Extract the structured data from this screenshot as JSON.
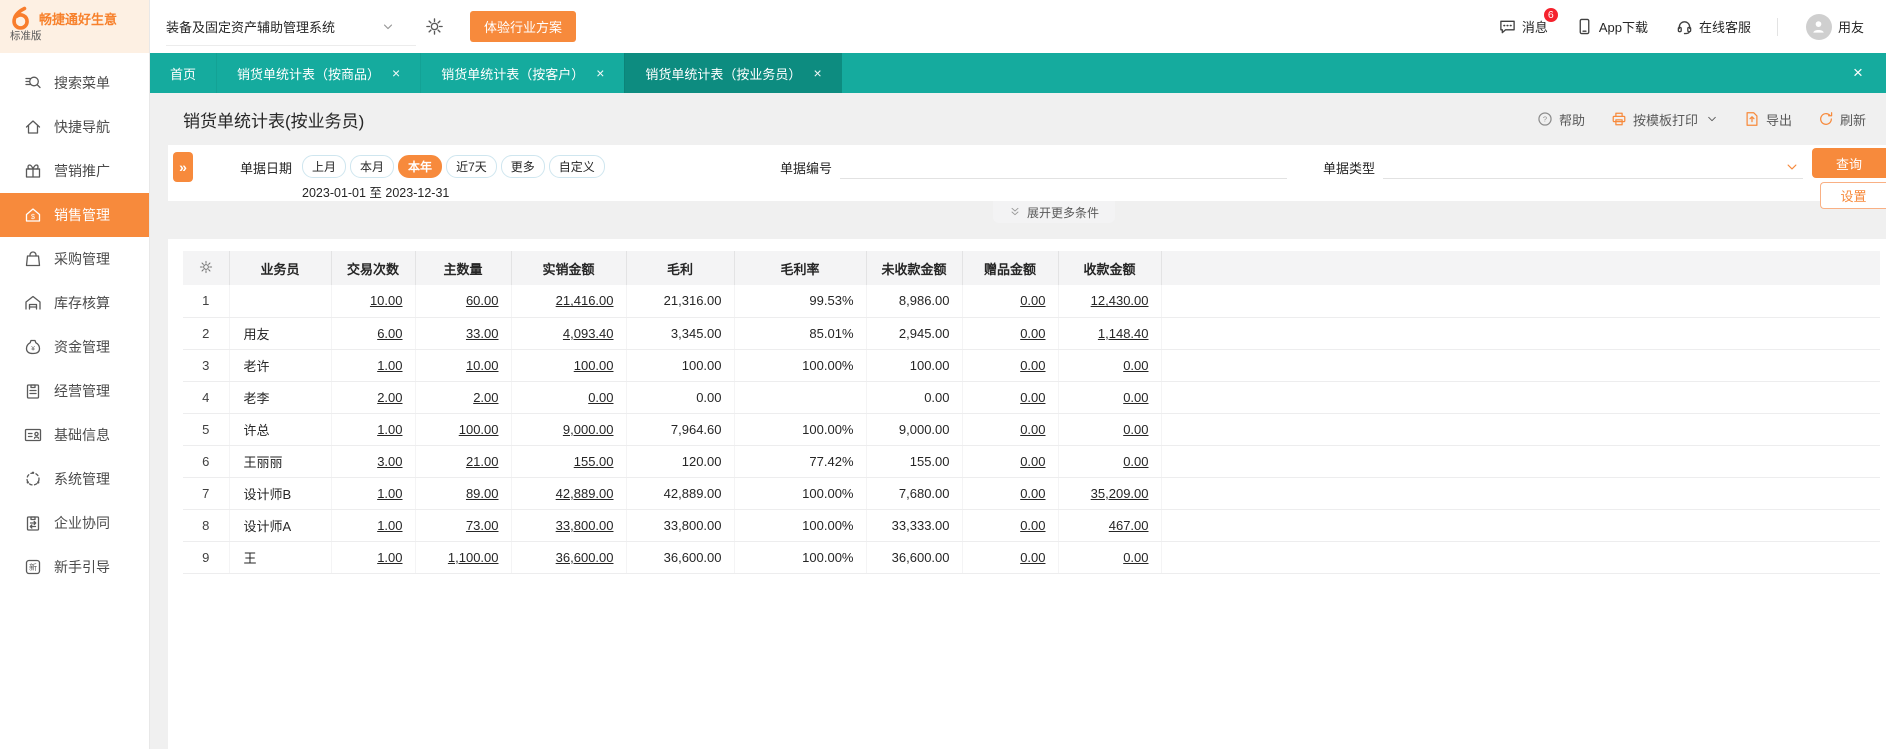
{
  "colors": {
    "accent": "#f78a3c",
    "teal": "#15ab9e",
    "teal_active": "#0d8c80",
    "badge_red": "#f5222d",
    "logo_cream": "#fdf0e3"
  },
  "brand": {
    "name": "畅捷通好生意",
    "edition": "标准版"
  },
  "topbar": {
    "system_select": {
      "value": "装备及固定资产辅助管理系统"
    },
    "trial_button": "体验行业方案",
    "messages_label": "消息",
    "messages_badge": "6",
    "app_download_label": "App下载",
    "online_service_label": "在线客服",
    "user_name": "用友"
  },
  "sidebar": {
    "items": [
      {
        "key": "search-menu",
        "icon": "search",
        "label": "搜索菜单",
        "active": false
      },
      {
        "key": "quick-nav",
        "icon": "home",
        "label": "快捷导航",
        "active": false
      },
      {
        "key": "marketing",
        "icon": "gift",
        "label": "营销推广",
        "active": false
      },
      {
        "key": "sales",
        "icon": "sales",
        "label": "销售管理",
        "active": true
      },
      {
        "key": "purchase",
        "icon": "purchase",
        "label": "采购管理",
        "active": false
      },
      {
        "key": "inventory",
        "icon": "inventory",
        "label": "库存核算",
        "active": false
      },
      {
        "key": "funds",
        "icon": "funds",
        "label": "资金管理",
        "active": false
      },
      {
        "key": "operations",
        "icon": "operations",
        "label": "经营管理",
        "active": false
      },
      {
        "key": "basic-info",
        "icon": "basic-info",
        "label": "基础信息",
        "active": false
      },
      {
        "key": "system",
        "icon": "system",
        "label": "系统管理",
        "active": false
      },
      {
        "key": "collaboration",
        "icon": "collab",
        "label": "企业协同",
        "active": false
      },
      {
        "key": "guide",
        "icon": "guide",
        "label": "新手引导",
        "active": false
      }
    ]
  },
  "tabbar": {
    "tabs": [
      {
        "label": "首页",
        "closable": false,
        "active": false
      },
      {
        "label": "销货单统计表（按商品）",
        "closable": true,
        "active": false
      },
      {
        "label": "销货单统计表（按客户）",
        "closable": true,
        "active": false
      },
      {
        "label": "销货单统计表（按业务员）",
        "closable": true,
        "active": true
      }
    ],
    "close_all": "×"
  },
  "page": {
    "title": "销货单统计表(按业务员)"
  },
  "toolbar": {
    "help": "帮助",
    "print": "按模板打印",
    "export": "导出",
    "refresh": "刷新"
  },
  "filters": {
    "date_label": "单据日期",
    "date_options": [
      {
        "label": "上月",
        "selected": false
      },
      {
        "label": "本月",
        "selected": false
      },
      {
        "label": "本年",
        "selected": true
      },
      {
        "label": "近7天",
        "selected": false
      },
      {
        "label": "更多",
        "selected": false
      },
      {
        "label": "自定义",
        "selected": false
      }
    ],
    "date_range": "2023-01-01 至 2023-12-31",
    "doc_no_label": "单据编号",
    "doc_no_value": "",
    "doc_type_label": "单据类型",
    "doc_type_value": "",
    "query_button": "查询",
    "settings_button": "设置",
    "expand_more": "展开更多条件"
  },
  "table": {
    "columns": [
      "业务员",
      "交易次数",
      "主数量",
      "实销金额",
      "毛利",
      "毛利率",
      "未收款金额",
      "赠品金额",
      "收款金额"
    ],
    "link_value_indices": [
      0,
      1,
      2,
      6,
      7
    ],
    "rows": [
      {
        "no": "1",
        "name": "",
        "values": [
          "10.00",
          "60.00",
          "21,416.00",
          "21,316.00",
          "99.53%",
          "8,986.00",
          "0.00",
          "12,430.00"
        ]
      },
      {
        "no": "2",
        "name": "用友",
        "values": [
          "6.00",
          "33.00",
          "4,093.40",
          "3,345.00",
          "85.01%",
          "2,945.00",
          "0.00",
          "1,148.40"
        ]
      },
      {
        "no": "3",
        "name": "老许",
        "values": [
          "1.00",
          "10.00",
          "100.00",
          "100.00",
          "100.00%",
          "100.00",
          "0.00",
          "0.00"
        ]
      },
      {
        "no": "4",
        "name": "老李",
        "values": [
          "2.00",
          "2.00",
          "0.00",
          "0.00",
          "",
          "0.00",
          "0.00",
          "0.00"
        ]
      },
      {
        "no": "5",
        "name": "许总",
        "values": [
          "1.00",
          "100.00",
          "9,000.00",
          "7,964.60",
          "100.00%",
          "9,000.00",
          "0.00",
          "0.00"
        ]
      },
      {
        "no": "6",
        "name": "王丽丽",
        "values": [
          "3.00",
          "21.00",
          "155.00",
          "120.00",
          "77.42%",
          "155.00",
          "0.00",
          "0.00"
        ]
      },
      {
        "no": "7",
        "name": "设计师B",
        "values": [
          "1.00",
          "89.00",
          "42,889.00",
          "42,889.00",
          "100.00%",
          "7,680.00",
          "0.00",
          "35,209.00"
        ]
      },
      {
        "no": "8",
        "name": "设计师A",
        "values": [
          "1.00",
          "73.00",
          "33,800.00",
          "33,800.00",
          "100.00%",
          "33,333.00",
          "0.00",
          "467.00"
        ]
      },
      {
        "no": "9",
        "name": "王",
        "values": [
          "1.00",
          "1,100.00",
          "36,600.00",
          "36,600.00",
          "100.00%",
          "36,600.00",
          "0.00",
          "0.00"
        ]
      }
    ]
  }
}
